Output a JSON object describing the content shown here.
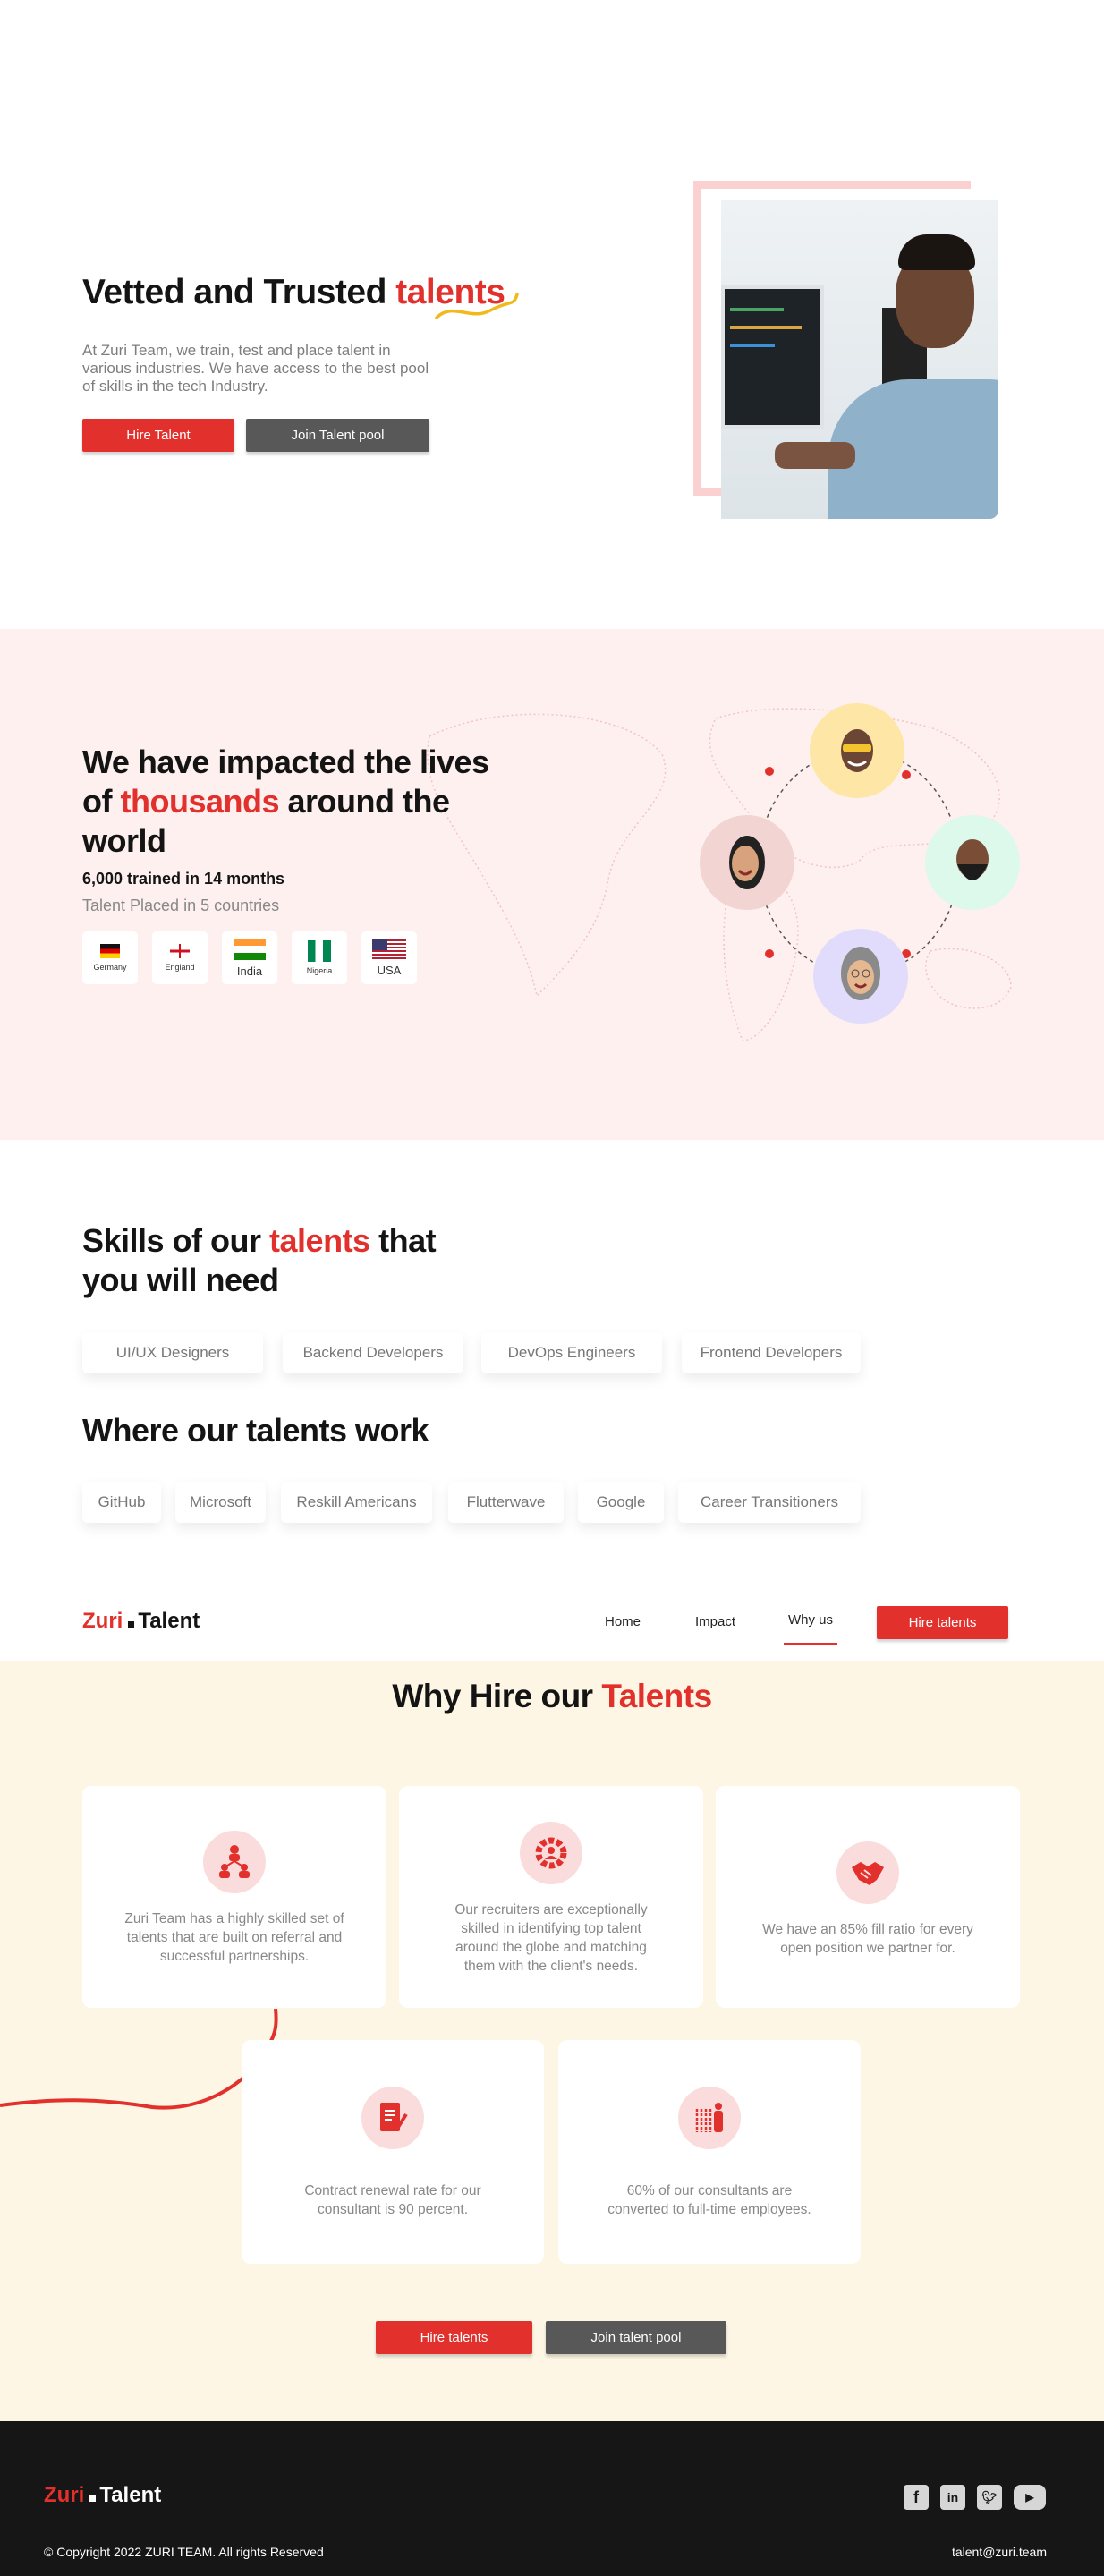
{
  "colors": {
    "accent": "#e2302c",
    "dark_button": "#585858",
    "impact_bg": "#fdf0ef",
    "why_bg": "#fdf6e4",
    "footer_bg": "#161616"
  },
  "hero": {
    "title_prefix": "Vetted and Trusted ",
    "title_highlight": "talents",
    "description": "At Zuri Team, we train, test and place talent in various industries. We have access to the best pool of skills in the tech Industry.",
    "hire_button": "Hire Talent",
    "join_button": "Join Talent pool"
  },
  "impact": {
    "title_line1": "We have impacted the lives",
    "title_of": "of ",
    "title_highlight": "thousands",
    "title_rest": " around the",
    "title_line3": "world",
    "trained": "6,000 trained in 14 months",
    "placed": "Talent Placed in 5 countries",
    "countries": [
      {
        "name": "Germany",
        "icon": "germany-flag"
      },
      {
        "name": "England",
        "icon": "england-flag"
      },
      {
        "name": "India",
        "icon": "india-flag"
      },
      {
        "name": "Nigeria",
        "icon": "nigeria-flag"
      },
      {
        "name": "USA",
        "icon": "usa-flag"
      }
    ]
  },
  "skills": {
    "title_prefix": "Skills of our ",
    "title_highlight": "talents",
    "title_suffix": " that",
    "title_line2": "you will need",
    "items": [
      "UI/UX Designers",
      "Backend Developers",
      "DevOps Engineers",
      "Frontend Developers"
    ]
  },
  "work": {
    "title": "Where our talents work",
    "items": [
      "GitHub",
      "Microsoft",
      "Reskill Americans",
      "Flutterwave",
      "Google",
      "Career Transitioners"
    ]
  },
  "nav": {
    "logo_zuri": "Zuri",
    "logo_talent": "Talent",
    "items": [
      "Home",
      "Impact",
      "Why us"
    ],
    "active": "Why us",
    "cta": "Hire talents"
  },
  "why": {
    "title_prefix": "Why Hire our ",
    "title_highlight": "Talents",
    "cards": [
      {
        "icon": "team-hierarchy-icon",
        "text": "Zuri Team has a highly skilled set of talents that are built on referral and successful partnerships."
      },
      {
        "icon": "gear-person-icon",
        "text": "Our recruiters are exceptionally skilled in identifying top talent around the globe and matching them with the client's needs."
      },
      {
        "icon": "handshake-icon",
        "text": "We have an 85% fill ratio for every open position we partner for."
      },
      {
        "icon": "contract-icon",
        "text": "Contract renewal rate for our consultant is 90 percent."
      },
      {
        "icon": "employees-icon",
        "text": "60% of our consultants are converted to full-time employees."
      }
    ],
    "hire_button": "Hire talents",
    "join_button": "Join talent pool"
  },
  "footer": {
    "logo_zuri": "Zuri",
    "logo_talent": "Talent",
    "copyright": "© Copyright 2022 ZURI TEAM. All rights Reserved",
    "email": "talent@zuri.team",
    "social": [
      "facebook-icon",
      "linkedin-icon",
      "twitter-icon",
      "youtube-icon"
    ]
  }
}
